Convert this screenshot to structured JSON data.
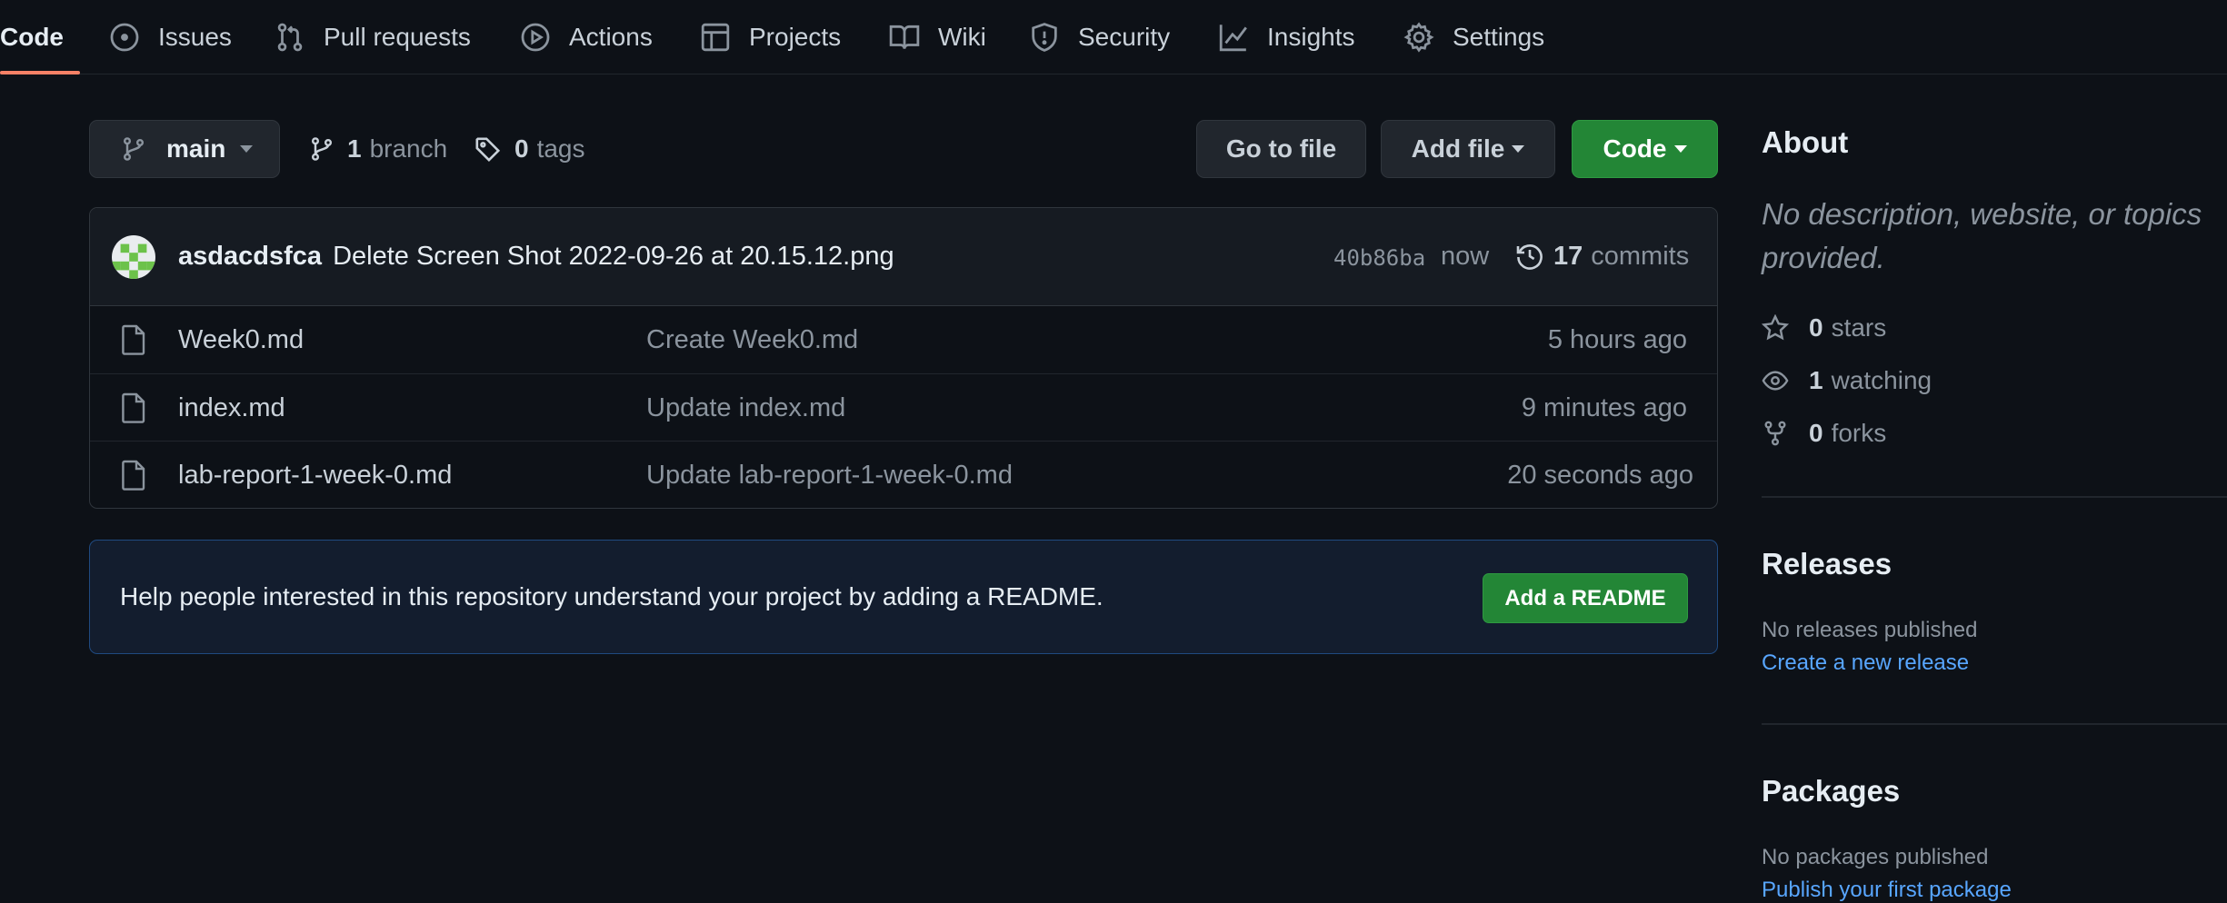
{
  "tabs": [
    {
      "label": "Code",
      "icon": "code-icon"
    },
    {
      "label": "Issues",
      "icon": "issue-opened-icon"
    },
    {
      "label": "Pull requests",
      "icon": "git-pull-request-icon"
    },
    {
      "label": "Actions",
      "icon": "play-icon"
    },
    {
      "label": "Projects",
      "icon": "table-icon"
    },
    {
      "label": "Wiki",
      "icon": "book-icon"
    },
    {
      "label": "Security",
      "icon": "shield-icon"
    },
    {
      "label": "Insights",
      "icon": "graph-icon"
    },
    {
      "label": "Settings",
      "icon": "gear-icon"
    }
  ],
  "toolbar": {
    "branch_name": "main",
    "branches_count": "1",
    "branches_label": "branch",
    "tags_count": "0",
    "tags_label": "tags",
    "go_to_file": "Go to file",
    "add_file": "Add file",
    "code": "Code"
  },
  "commit": {
    "author": "asdacdsfca",
    "message": "Delete Screen Shot 2022-09-26 at 20.15.12.png",
    "sha": "40b86ba",
    "time": "now",
    "commits_count": "17",
    "commits_label": "commits"
  },
  "files": [
    {
      "name": "Week0.md",
      "message": "Create Week0.md",
      "age": "5 hours ago"
    },
    {
      "name": "index.md",
      "message": "Update index.md",
      "age": "9 minutes ago"
    },
    {
      "name": "lab-report-1-week-0.md",
      "message": "Update lab-report-1-week-0.md",
      "age": "20 seconds ago"
    }
  ],
  "readme_banner": {
    "text": "Help people interested in this repository understand your project by adding a README.",
    "button": "Add a README"
  },
  "sidebar": {
    "about_title": "About",
    "about_desc": "No description, website, or topics provided.",
    "stars_count": "0",
    "stars_label": "stars",
    "watching_count": "1",
    "watching_label": "watching",
    "forks_count": "0",
    "forks_label": "forks",
    "releases_title": "Releases",
    "releases_empty": "No releases published",
    "releases_link": "Create a new release",
    "packages_title": "Packages",
    "packages_empty": "No packages published",
    "packages_link": "Publish your first package"
  },
  "colors": {
    "background": "#0d1117",
    "accent_underline": "#f78166",
    "primary_button": "#238636",
    "link": "#58a6ff",
    "readme_banner_bg": "#131d2e",
    "readme_banner_border": "#1f4a80"
  }
}
